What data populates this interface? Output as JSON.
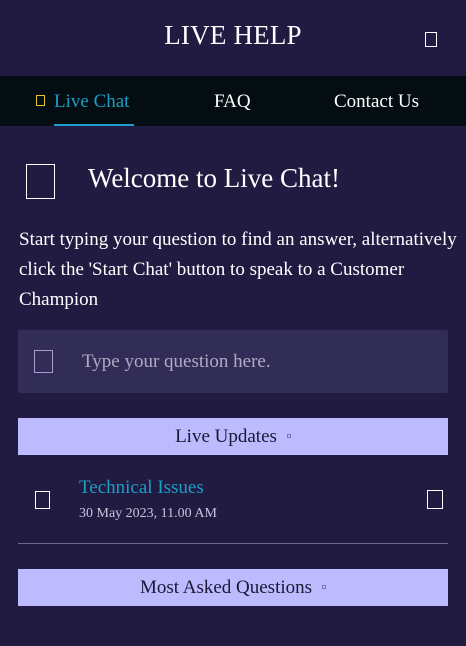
{
  "header": {
    "title": "LIVE HELP",
    "close_icon": "close-icon"
  },
  "tabs": [
    {
      "label": "Live Chat",
      "icon": "chat-icon",
      "active": true
    },
    {
      "label": "FAQ",
      "active": false
    },
    {
      "label": "Contact Us",
      "active": false
    }
  ],
  "welcome": {
    "icon": "chat-bubble-icon",
    "title": "Welcome to Live Chat!",
    "intro": "Start typing your question to find an answer, alternatively click the 'Start Chat' button to speak to a Customer Champion"
  },
  "search": {
    "icon": "search-icon",
    "placeholder": "Type your question here.",
    "value": ""
  },
  "live_updates": {
    "label": "Live Updates",
    "toggle_icon": "chevron-icon",
    "items": [
      {
        "icon": "alert-icon",
        "title": "Technical Issues",
        "date": "30 May 2023, 11.00 AM",
        "arrow_icon": "chevron-right-icon"
      }
    ]
  },
  "most_asked": {
    "label": "Most Asked Questions",
    "toggle_icon": "chevron-icon"
  },
  "colors": {
    "background": "#211b42",
    "tab_bar": "#030d12",
    "accent": "#1b9ec8",
    "section_bar": "#bdbbfe",
    "search_bg": "#322d56"
  }
}
